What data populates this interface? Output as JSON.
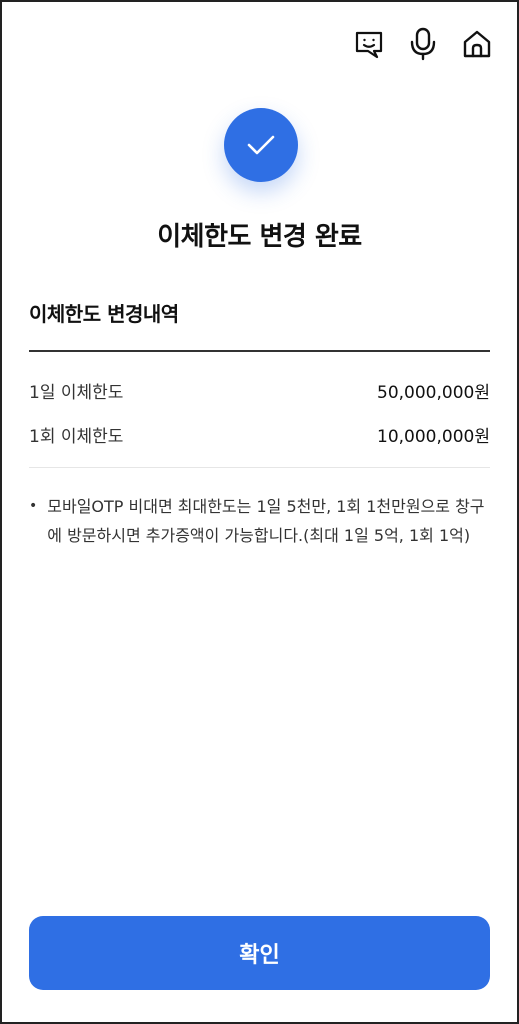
{
  "header": {
    "icons": [
      "chatbot-icon",
      "microphone-icon",
      "home-icon"
    ]
  },
  "result": {
    "title": "이체한도 변경 완료"
  },
  "details": {
    "section_title": "이체한도 변경내역",
    "rows": [
      {
        "label": "1일 이체한도",
        "value": "50,000,000원"
      },
      {
        "label": "1회 이체한도",
        "value": "10,000,000원"
      }
    ]
  },
  "notice": {
    "text": "모바일OTP 비대면 최대한도는 1일 5천만, 1회 1천만원으로 창구에 방문하시면 추가증액이 가능합니다.(최대 1일 5억, 1회 1억)"
  },
  "footer": {
    "confirm_label": "확인"
  },
  "colors": {
    "accent": "#2f6fe4"
  }
}
